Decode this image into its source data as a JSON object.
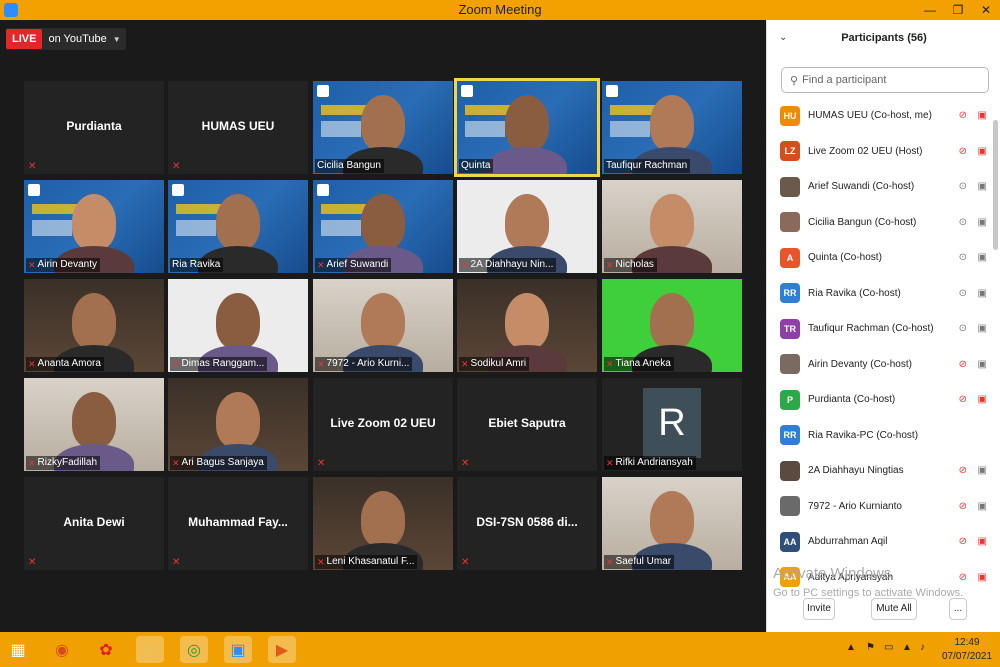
{
  "window": {
    "title": "Zoom Meeting"
  },
  "live": {
    "badge": "LIVE",
    "label": "on YouTube"
  },
  "tiles": [
    {
      "name": "Purdianta",
      "type": "name"
    },
    {
      "name": "HUMAS UEU",
      "type": "name"
    },
    {
      "name": "Cicilia Bangun",
      "type": "slide"
    },
    {
      "name": "Quinta",
      "type": "slide",
      "active": true
    },
    {
      "name": "Taufiqur Rachman",
      "type": "slide"
    },
    {
      "name": "Airin Devanty",
      "type": "slide"
    },
    {
      "name": "Ria Ravika",
      "type": "slide"
    },
    {
      "name": "Arief Suwandi",
      "type": "slide"
    },
    {
      "name": "2A Diahhayu Nin...",
      "type": "video"
    },
    {
      "name": "Nicholas",
      "type": "video"
    },
    {
      "name": "Ananta Amora",
      "type": "video"
    },
    {
      "name": "Dimas Ranggam...",
      "type": "video"
    },
    {
      "name": "7972 - Ario Kurni...",
      "type": "video"
    },
    {
      "name": "Sodikul Amri",
      "type": "video"
    },
    {
      "name": "Tiana Aneka",
      "type": "video"
    },
    {
      "name": "RizkyFadillah",
      "type": "video"
    },
    {
      "name": "Ari Bagus Sanjaya",
      "type": "video"
    },
    {
      "name": "Live Zoom 02 UEU",
      "type": "name"
    },
    {
      "name": "Ebiet Saputra",
      "type": "name"
    },
    {
      "name": "Rifki Andriansyah",
      "type": "avatar",
      "initial": "R"
    },
    {
      "name": "Anita Dewi",
      "type": "name"
    },
    {
      "name": "Muhammad  Fay...",
      "type": "name"
    },
    {
      "name": "Leni Khasanatul F...",
      "type": "video"
    },
    {
      "name": "DSI-7SN 0586 di...",
      "type": "name"
    },
    {
      "name": "Saeful Umar",
      "type": "video"
    }
  ],
  "panel": {
    "title": "Participants (56)",
    "search_placeholder": "Find a participant",
    "participants": [
      {
        "initials": "HU",
        "color": "#f08a00",
        "name": "HUMAS UEU (Co-host, me)",
        "mic": "muted",
        "cam": "off"
      },
      {
        "initials": "LZ",
        "color": "#d4501a",
        "name": "Live Zoom 02 UEU (Host)",
        "mic": "muted",
        "cam": "off"
      },
      {
        "initials": "",
        "color": "#6b5a4c",
        "name": "Arief Suwandi (Co-host)",
        "mic": "on",
        "cam": "on"
      },
      {
        "initials": "",
        "color": "#8a6a5a",
        "name": "Cicilia Bangun (Co-host)",
        "mic": "on",
        "cam": "on"
      },
      {
        "initials": "A",
        "color": "#e8552a",
        "name": "Quinta (Co-host)",
        "mic": "on",
        "cam": "on"
      },
      {
        "initials": "RR",
        "color": "#2f7fd6",
        "name": "Ria Ravika (Co-host)",
        "mic": "on",
        "cam": "on"
      },
      {
        "initials": "TR",
        "color": "#8e3fa8",
        "name": "Taufiqur Rachman (Co-host)",
        "mic": "on",
        "cam": "on"
      },
      {
        "initials": "",
        "color": "#7a6a60",
        "name": "Airin Devanty (Co-host)",
        "mic": "muted",
        "cam": "on"
      },
      {
        "initials": "P",
        "color": "#2aa84a",
        "name": "Purdianta (Co-host)",
        "mic": "muted",
        "cam": "off"
      },
      {
        "initials": "RR",
        "color": "#2f7fd6",
        "name": "Ria Ravika-PC (Co-host)",
        "mic": "none",
        "cam": "none"
      },
      {
        "initials": "",
        "color": "#5a4a40",
        "name": "2A Diahhayu Ningtias",
        "mic": "muted",
        "cam": "on"
      },
      {
        "initials": "",
        "color": "#6a6a6a",
        "name": "7972 - Ario Kurnianto",
        "mic": "muted",
        "cam": "on"
      },
      {
        "initials": "AA",
        "color": "#2d4f7a",
        "name": "Abdurrahman Aqil",
        "mic": "muted",
        "cam": "off"
      },
      {
        "initials": "AA",
        "color": "#f0a000",
        "name": "Aditya Apriyansyah",
        "mic": "muted",
        "cam": "off"
      }
    ],
    "watermark_title": "Activate Windows",
    "watermark_sub": "Go to PC settings to activate Windows.",
    "invite": "Invite",
    "mute_all": "Mute All",
    "more": "..."
  },
  "taskbar": {
    "time": "12:49",
    "date": "07/07/2021"
  }
}
